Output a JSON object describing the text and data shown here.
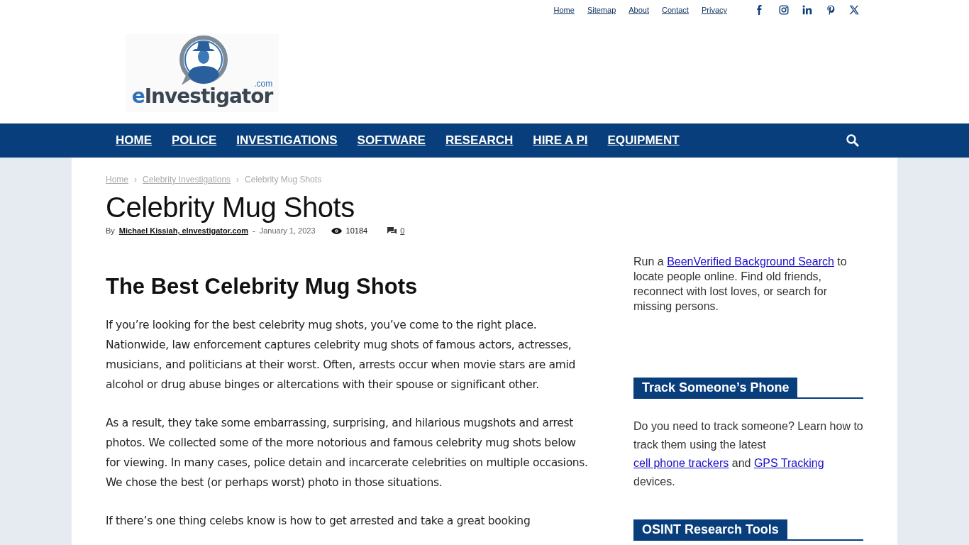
{
  "top_links": [
    "Home",
    "Sitemap",
    "About",
    "Contact",
    "Privacy"
  ],
  "logo": {
    "name": "eInvestigator",
    "suffix": ".com"
  },
  "nav": [
    "HOME",
    "POLICE",
    "INVESTIGATIONS",
    "SOFTWARE",
    "RESEARCH",
    "HIRE A PI",
    "EQUIPMENT"
  ],
  "breadcrumbs": [
    {
      "kind": "link",
      "text": "Home"
    },
    {
      "kind": "sep",
      "text": "›"
    },
    {
      "kind": "link",
      "text": "Celebrity Investigations"
    },
    {
      "kind": "sep",
      "text": "›"
    },
    {
      "kind": "current",
      "text": "Celebrity Mug Shots"
    }
  ],
  "title": "Celebrity Mug Shots",
  "meta": {
    "by": "By",
    "author": "Michael Kissiah, eInvestigator.com",
    "dash": "-",
    "date": "January 1, 2023",
    "views": "10184",
    "comments": "0"
  },
  "heading": "The Best Celebrity Mug Shots",
  "paragraphs": [
    "If you’re looking for the best celebrity mug shots, you’ve come to the right place. Nationwide, law enforcement captures celebrity mug shots of famous actors, actresses, musicians, and politicians at their worst. Often, arrests occur when movie stars are amid alcohol or drug abuse binges or altercations with their spouse or significant other.",
    "As a result, they take some embarrassing, surprising, and hilarious mugshots and arrest photos. We collected some of the more notorious and famous celebrity mug shots below for viewing. In many cases, police detain and incarcerate celebrities on multiple occasions. We chose the best (or perhaps worst) photo in those situations.",
    "If there’s one thing celebs know is how to get arrested and take a great booking"
  ],
  "sidebar": [
    {
      "kind": "text",
      "segments": [
        {
          "text": "Run a "
        },
        {
          "link": "BeenVerified Background Search"
        },
        {
          "text": " to locate people online. Find old friends, reconnect with lost loves, or search for missing persons."
        }
      ]
    },
    {
      "kind": "titled",
      "title": "Track Someone’s Phone",
      "segments": [
        {
          "text": "Do you need to track someone? Learn how to track them using the latest "
        },
        {
          "link": "cell phone trackers"
        },
        {
          "text": " and "
        },
        {
          "link": "GPS Tracking"
        },
        {
          "text": " devices."
        }
      ]
    },
    {
      "kind": "titled",
      "title": "OSINT Research Tools"
    }
  ]
}
